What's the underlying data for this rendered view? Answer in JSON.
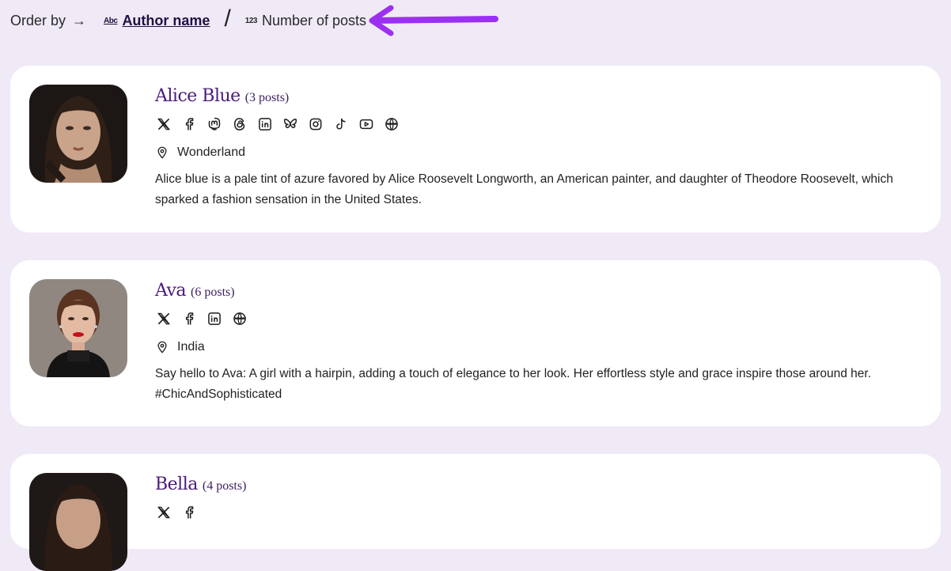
{
  "order_bar": {
    "label": "Order by",
    "arrow": "→",
    "options": [
      {
        "icon_text": "Abc",
        "label": "Author name",
        "active": true
      },
      {
        "icon_text": "123",
        "label": "Number of posts",
        "active": false
      }
    ],
    "separator": "/"
  },
  "colors": {
    "background": "#f0e9f6",
    "card": "#ffffff",
    "accent": "#4b1a7a",
    "pointer_arrow": "#9b30f0"
  },
  "authors": [
    {
      "name": "Alice Blue",
      "posts": "(3 posts)",
      "socials": [
        "x-icon",
        "facebook-icon",
        "mastodon-icon",
        "threads-icon",
        "linkedin-icon",
        "bluesky-icon",
        "instagram-icon",
        "tiktok-icon",
        "youtube-icon",
        "website-icon"
      ],
      "location": "Wonderland",
      "bio": "Alice blue is a pale tint of azure favored by Alice Roosevelt Longworth, an American painter, and daughter of Theodore Roosevelt, which sparked a fashion sensation in the United States."
    },
    {
      "name": "Ava",
      "posts": "(6 posts)",
      "socials": [
        "x-icon",
        "facebook-icon",
        "linkedin-icon",
        "website-icon"
      ],
      "location": "India",
      "bio": "Say hello to Ava: A girl with a hairpin, adding a touch of elegance to her look. Her effortless style and grace inspire those around her. #ChicAndSophisticated"
    },
    {
      "name": "Bella",
      "posts": "(4 posts)",
      "socials": [
        "x-icon",
        "facebook-icon"
      ],
      "location": "",
      "bio": ""
    }
  ]
}
